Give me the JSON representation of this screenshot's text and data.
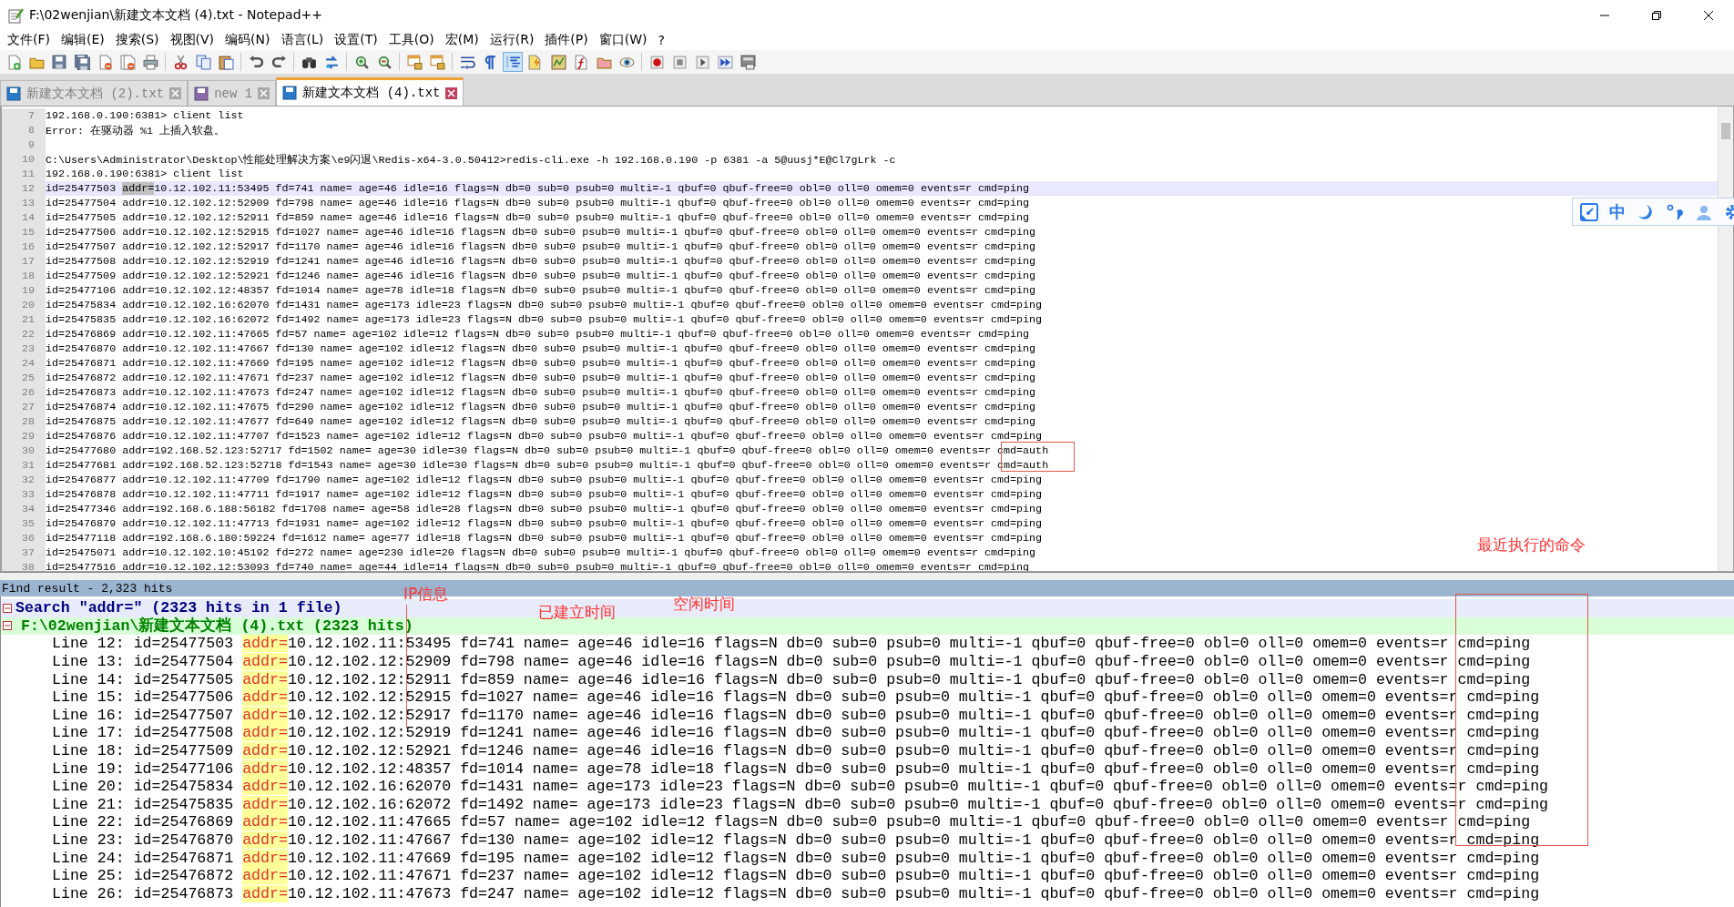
{
  "window": {
    "title": "F:\\02wenjian\\新建文本文档 (4).txt - Notepad++"
  },
  "menu": [
    "文件(F)",
    "编辑(E)",
    "搜索(S)",
    "视图(V)",
    "编码(N)",
    "语言(L)",
    "设置(T)",
    "工具(O)",
    "宏(M)",
    "运行(R)",
    "插件(P)",
    "窗口(W)",
    "?"
  ],
  "toolbar": [
    {
      "kind": "new",
      "pressed": false
    },
    {
      "kind": "open",
      "pressed": false
    },
    {
      "kind": "save",
      "pressed": false
    },
    {
      "kind": "saveall",
      "pressed": false
    },
    {
      "kind": "close",
      "pressed": false
    },
    {
      "kind": "closeall",
      "pressed": false
    },
    {
      "kind": "print",
      "pressed": false
    },
    {
      "kind": "sep"
    },
    {
      "kind": "cut",
      "pressed": false
    },
    {
      "kind": "copy",
      "pressed": false
    },
    {
      "kind": "paste",
      "pressed": false
    },
    {
      "kind": "sep"
    },
    {
      "kind": "undo",
      "pressed": false
    },
    {
      "kind": "redo",
      "pressed": false
    },
    {
      "kind": "sep"
    },
    {
      "kind": "find",
      "pressed": false
    },
    {
      "kind": "replace",
      "pressed": false
    },
    {
      "kind": "sep"
    },
    {
      "kind": "zoomin",
      "pressed": false
    },
    {
      "kind": "zoomout",
      "pressed": false
    },
    {
      "kind": "sep"
    },
    {
      "kind": "syncv",
      "pressed": false
    },
    {
      "kind": "synch",
      "pressed": false
    },
    {
      "kind": "sep"
    },
    {
      "kind": "wrap",
      "pressed": false
    },
    {
      "kind": "allchars",
      "pressed": false
    },
    {
      "kind": "indent",
      "pressed": true
    },
    {
      "kind": "lang",
      "pressed": false
    },
    {
      "kind": "map",
      "pressed": false
    },
    {
      "kind": "func",
      "pressed": false
    },
    {
      "kind": "folder",
      "pressed": false
    },
    {
      "kind": "monitor",
      "pressed": false
    },
    {
      "kind": "sep"
    },
    {
      "kind": "record",
      "pressed": false
    },
    {
      "kind": "stop",
      "pressed": false
    },
    {
      "kind": "play",
      "pressed": false
    },
    {
      "kind": "playmulti",
      "pressed": false
    },
    {
      "kind": "savemacro",
      "pressed": false
    }
  ],
  "tabs": [
    {
      "label": "新建文本文档 (2).txt",
      "selected": false
    },
    {
      "label": "new 1",
      "selected": false
    },
    {
      "label": "新建文本文档 (4).txt",
      "selected": true
    }
  ],
  "editor": {
    "lines": [
      {
        "num": "7",
        "text": "192.168.0.190:6381> client list",
        "current": false
      },
      {
        "num": "8",
        "text": "Error: 在驱动器 %1 上插入软盘。",
        "current": false
      },
      {
        "num": "9",
        "current": false
      },
      {
        "num": "10",
        "text": "C:\\Users\\Administrator\\Desktop\\性能处理解决方案\\e9闪退\\Redis-x64-3.0.50412>redis-cli.exe -h 192.168.0.190 -p 6381 -a 5@uusj*E@Cl7gLrk -c",
        "current": false
      },
      {
        "num": "11",
        "text": "192.168.0.190:6381> client list",
        "current": false
      },
      {
        "num": "12",
        "current": true,
        "segments": [
          {
            "text": "id=25477503 ",
            "highlight": false
          },
          {
            "text": "addr=",
            "highlight": true
          },
          {
            "text": "10.12.102.11:53495 fd=741 name= age=46 idle=16 flags=N db=0 sub=0 psub=0 multi=-1 qbuf=0 qbuf-free=0 obl=0 oll=0 omem=0 events=r cmd=ping",
            "highlight": false
          }
        ]
      },
      {
        "num": "13",
        "text": "id=25477504 addr=10.12.102.12:52909 fd=798 name= age=46 idle=16 flags=N db=0 sub=0 psub=0 multi=-1 qbuf=0 qbuf-free=0 obl=0 oll=0 omem=0 events=r cmd=ping",
        "current": false
      },
      {
        "num": "14",
        "text": "id=25477505 addr=10.12.102.12:52911 fd=859 name= age=46 idle=16 flags=N db=0 sub=0 psub=0 multi=-1 qbuf=0 qbuf-free=0 obl=0 oll=0 omem=0 events=r cmd=ping",
        "current": false
      },
      {
        "num": "15",
        "text": "id=25477506 addr=10.12.102.12:52915 fd=1027 name= age=46 idle=16 flags=N db=0 sub=0 psub=0 multi=-1 qbuf=0 qbuf-free=0 obl=0 oll=0 omem=0 events=r cmd=ping",
        "current": false
      },
      {
        "num": "16",
        "text": "id=25477507 addr=10.12.102.12:52917 fd=1170 name= age=46 idle=16 flags=N db=0 sub=0 psub=0 multi=-1 qbuf=0 qbuf-free=0 obl=0 oll=0 omem=0 events=r cmd=ping",
        "current": false
      },
      {
        "num": "17",
        "text": "id=25477508 addr=10.12.102.12:52919 fd=1241 name= age=46 idle=16 flags=N db=0 sub=0 psub=0 multi=-1 qbuf=0 qbuf-free=0 obl=0 oll=0 omem=0 events=r cmd=ping",
        "current": false
      },
      {
        "num": "18",
        "text": "id=25477509 addr=10.12.102.12:52921 fd=1246 name= age=46 idle=16 flags=N db=0 sub=0 psub=0 multi=-1 qbuf=0 qbuf-free=0 obl=0 oll=0 omem=0 events=r cmd=ping",
        "current": false
      },
      {
        "num": "19",
        "text": "id=25477106 addr=10.12.102.12:48357 fd=1014 name= age=78 idle=18 flags=N db=0 sub=0 psub=0 multi=-1 qbuf=0 qbuf-free=0 obl=0 oll=0 omem=0 events=r cmd=ping",
        "current": false
      },
      {
        "num": "20",
        "text": "id=25475834 addr=10.12.102.16:62070 fd=1431 name= age=173 idle=23 flags=N db=0 sub=0 psub=0 multi=-1 qbuf=0 qbuf-free=0 obl=0 oll=0 omem=0 events=r cmd=ping",
        "current": false
      },
      {
        "num": "21",
        "text": "id=25475835 addr=10.12.102.16:62072 fd=1492 name= age=173 idle=23 flags=N db=0 sub=0 psub=0 multi=-1 qbuf=0 qbuf-free=0 obl=0 oll=0 omem=0 events=r cmd=ping",
        "current": false
      },
      {
        "num": "22",
        "text": "id=25476869 addr=10.12.102.11:47665 fd=57 name= age=102 idle=12 flags=N db=0 sub=0 psub=0 multi=-1 qbuf=0 qbuf-free=0 obl=0 oll=0 omem=0 events=r cmd=ping",
        "current": false
      },
      {
        "num": "23",
        "text": "id=25476870 addr=10.12.102.11:47667 fd=130 name= age=102 idle=12 flags=N db=0 sub=0 psub=0 multi=-1 qbuf=0 qbuf-free=0 obl=0 oll=0 omem=0 events=r cmd=ping",
        "current": false
      },
      {
        "num": "24",
        "text": "id=25476871 addr=10.12.102.11:47669 fd=195 name= age=102 idle=12 flags=N db=0 sub=0 psub=0 multi=-1 qbuf=0 qbuf-free=0 obl=0 oll=0 omem=0 events=r cmd=ping",
        "current": false
      },
      {
        "num": "25",
        "text": "id=25476872 addr=10.12.102.11:47671 fd=237 name= age=102 idle=12 flags=N db=0 sub=0 psub=0 multi=-1 qbuf=0 qbuf-free=0 obl=0 oll=0 omem=0 events=r cmd=ping",
        "current": false
      },
      {
        "num": "26",
        "text": "id=25476873 addr=10.12.102.11:47673 fd=247 name= age=102 idle=12 flags=N db=0 sub=0 psub=0 multi=-1 qbuf=0 qbuf-free=0 obl=0 oll=0 omem=0 events=r cmd=ping",
        "current": false
      },
      {
        "num": "27",
        "text": "id=25476874 addr=10.12.102.11:47675 fd=290 name= age=102 idle=12 flags=N db=0 sub=0 psub=0 multi=-1 qbuf=0 qbuf-free=0 obl=0 oll=0 omem=0 events=r cmd=ping",
        "current": false
      },
      {
        "num": "28",
        "text": "id=25476875 addr=10.12.102.11:47677 fd=649 name= age=102 idle=12 flags=N db=0 sub=0 psub=0 multi=-1 qbuf=0 qbuf-free=0 obl=0 oll=0 omem=0 events=r cmd=ping",
        "current": false
      },
      {
        "num": "29",
        "text": "id=25476876 addr=10.12.102.11:47707 fd=1523 name= age=102 idle=12 flags=N db=0 sub=0 psub=0 multi=-1 qbuf=0 qbuf-free=0 obl=0 oll=0 omem=0 events=r cmd=ping",
        "current": false
      },
      {
        "num": "30",
        "text": "id=25477680 addr=192.168.52.123:52717 fd=1502 name= age=30 idle=30 flags=N db=0 sub=0 psub=0 multi=-1 qbuf=0 qbuf-free=0 obl=0 oll=0 omem=0 events=r cmd=auth",
        "current": false
      },
      {
        "num": "31",
        "text": "id=25477681 addr=192.168.52.123:52718 fd=1543 name= age=30 idle=30 flags=N db=0 sub=0 psub=0 multi=-1 qbuf=0 qbuf-free=0 obl=0 oll=0 omem=0 events=r cmd=auth",
        "current": false
      },
      {
        "num": "32",
        "text": "id=25476877 addr=10.12.102.11:47709 fd=1790 name= age=102 idle=12 flags=N db=0 sub=0 psub=0 multi=-1 qbuf=0 qbuf-free=0 obl=0 oll=0 omem=0 events=r cmd=ping",
        "current": false
      },
      {
        "num": "33",
        "text": "id=25476878 addr=10.12.102.11:47711 fd=1917 name= age=102 idle=12 flags=N db=0 sub=0 psub=0 multi=-1 qbuf=0 qbuf-free=0 obl=0 oll=0 omem=0 events=r cmd=ping",
        "current": false
      },
      {
        "num": "34",
        "text": "id=25477346 addr=192.168.6.188:56182 fd=1708 name= age=58 idle=28 flags=N db=0 sub=0 psub=0 multi=-1 qbuf=0 qbuf-free=0 obl=0 oll=0 omem=0 events=r cmd=ping",
        "current": false
      },
      {
        "num": "35",
        "text": "id=25476879 addr=10.12.102.11:47713 fd=1931 name= age=102 idle=12 flags=N db=0 sub=0 psub=0 multi=-1 qbuf=0 qbuf-free=0 obl=0 oll=0 omem=0 events=r cmd=ping",
        "current": false
      },
      {
        "num": "36",
        "text": "id=25477118 addr=192.168.6.180:59224 fd=1612 name= age=77 idle=18 flags=N db=0 sub=0 psub=0 multi=-1 qbuf=0 qbuf-free=0 obl=0 oll=0 omem=0 events=r cmd=ping",
        "current": false
      },
      {
        "num": "37",
        "text": "id=25475071 addr=10.12.102.10:45192 fd=272 name= age=230 idle=20 flags=N db=0 sub=0 psub=0 multi=-1 qbuf=0 qbuf-free=0 obl=0 oll=0 omem=0 events=r cmd=ping",
        "current": false
      },
      {
        "num": "38",
        "text": "id=25477516 addr=10.12.102.12:53093 fd=740 name= age=44 idle=14 flags=N db=0 sub=0 psub=0 multi=-1 qbuf=0 qbuf-free=0 obl=0 oll=0 omem=0 events=r cmd=ping",
        "current": false
      }
    ]
  },
  "ime_bar": {
    "mode": "中"
  },
  "find_results": {
    "title": "Find result - 2,323 hits",
    "search": {
      "text": "Search \"addr=\" (2323 hits in 1 file)",
      "expanded": true
    },
    "file": {
      "text": "F:\\02wenjian\\新建文本文档 (4).txt (2323 hits)",
      "expanded": true
    },
    "hits": [
      {
        "label": "Line 12:",
        "before": "id=25477503 ",
        "match": "addr=",
        "after": "10.12.102.11:53495 fd=741 name= age=46 idle=16 flags=N db=0 sub=0 psub=0 multi=-1 qbuf=0 qbuf-free=0 obl=0 oll=0 omem=0 events=r cmd=ping"
      },
      {
        "label": "Line 13:",
        "before": "id=25477504 ",
        "match": "addr=",
        "after": "10.12.102.12:52909 fd=798 name= age=46 idle=16 flags=N db=0 sub=0 psub=0 multi=-1 qbuf=0 qbuf-free=0 obl=0 oll=0 omem=0 events=r cmd=ping"
      },
      {
        "label": "Line 14:",
        "before": "id=25477505 ",
        "match": "addr=",
        "after": "10.12.102.12:52911 fd=859 name= age=46 idle=16 flags=N db=0 sub=0 psub=0 multi=-1 qbuf=0 qbuf-free=0 obl=0 oll=0 omem=0 events=r cmd=ping"
      },
      {
        "label": "Line 15:",
        "before": "id=25477506 ",
        "match": "addr=",
        "after": "10.12.102.12:52915 fd=1027 name= age=46 idle=16 flags=N db=0 sub=0 psub=0 multi=-1 qbuf=0 qbuf-free=0 obl=0 oll=0 omem=0 events=r cmd=ping"
      },
      {
        "label": "Line 16:",
        "before": "id=25477507 ",
        "match": "addr=",
        "after": "10.12.102.12:52917 fd=1170 name= age=46 idle=16 flags=N db=0 sub=0 psub=0 multi=-1 qbuf=0 qbuf-free=0 obl=0 oll=0 omem=0 events=r cmd=ping"
      },
      {
        "label": "Line 17:",
        "before": "id=25477508 ",
        "match": "addr=",
        "after": "10.12.102.12:52919 fd=1241 name= age=46 idle=16 flags=N db=0 sub=0 psub=0 multi=-1 qbuf=0 qbuf-free=0 obl=0 oll=0 omem=0 events=r cmd=ping"
      },
      {
        "label": "Line 18:",
        "before": "id=25477509 ",
        "match": "addr=",
        "after": "10.12.102.12:52921 fd=1246 name= age=46 idle=16 flags=N db=0 sub=0 psub=0 multi=-1 qbuf=0 qbuf-free=0 obl=0 oll=0 omem=0 events=r cmd=ping"
      },
      {
        "label": "Line 19:",
        "before": "id=25477106 ",
        "match": "addr=",
        "after": "10.12.102.12:48357 fd=1014 name= age=78 idle=18 flags=N db=0 sub=0 psub=0 multi=-1 qbuf=0 qbuf-free=0 obl=0 oll=0 omem=0 events=r cmd=ping"
      },
      {
        "label": "Line 20:",
        "before": "id=25475834 ",
        "match": "addr=",
        "after": "10.12.102.16:62070 fd=1431 name= age=173 idle=23 flags=N db=0 sub=0 psub=0 multi=-1 qbuf=0 qbuf-free=0 obl=0 oll=0 omem=0 events=r cmd=ping"
      },
      {
        "label": "Line 21:",
        "before": "id=25475835 ",
        "match": "addr=",
        "after": "10.12.102.16:62072 fd=1492 name= age=173 idle=23 flags=N db=0 sub=0 psub=0 multi=-1 qbuf=0 qbuf-free=0 obl=0 oll=0 omem=0 events=r cmd=ping"
      },
      {
        "label": "Line 22:",
        "before": "id=25476869 ",
        "match": "addr=",
        "after": "10.12.102.11:47665 fd=57 name= age=102 idle=12 flags=N db=0 sub=0 psub=0 multi=-1 qbuf=0 qbuf-free=0 obl=0 oll=0 omem=0 events=r cmd=ping"
      },
      {
        "label": "Line 23:",
        "before": "id=25476870 ",
        "match": "addr=",
        "after": "10.12.102.11:47667 fd=130 name= age=102 idle=12 flags=N db=0 sub=0 psub=0 multi=-1 qbuf=0 qbuf-free=0 obl=0 oll=0 omem=0 events=r cmd=ping"
      },
      {
        "label": "Line 24:",
        "before": "id=25476871 ",
        "match": "addr=",
        "after": "10.12.102.11:47669 fd=195 name= age=102 idle=12 flags=N db=0 sub=0 psub=0 multi=-1 qbuf=0 qbuf-free=0 obl=0 oll=0 omem=0 events=r cmd=ping"
      },
      {
        "label": "Line 25:",
        "before": "id=25476872 ",
        "match": "addr=",
        "after": "10.12.102.11:47671 fd=237 name= age=102 idle=12 flags=N db=0 sub=0 psub=0 multi=-1 qbuf=0 qbuf-free=0 obl=0 oll=0 omem=0 events=r cmd=ping"
      },
      {
        "label": "Line 26:",
        "before": "id=25476873 ",
        "match": "addr=",
        "after": "10.12.102.11:47673 fd=247 name= age=102 idle=12 flags=N db=0 sub=0 psub=0 multi=-1 qbuf=0 qbuf-free=0 obl=0 oll=0 omem=0 events=r cmd=ping"
      }
    ]
  },
  "annotations": [
    {
      "kind": "label",
      "text": "IP信息"
    },
    {
      "kind": "label",
      "text": "已建立时间"
    },
    {
      "kind": "label",
      "text": "空闲时间"
    },
    {
      "kind": "label",
      "text": "最近执行的命令"
    },
    {
      "kind": "box"
    },
    {
      "kind": "box"
    },
    {
      "kind": "line"
    }
  ]
}
